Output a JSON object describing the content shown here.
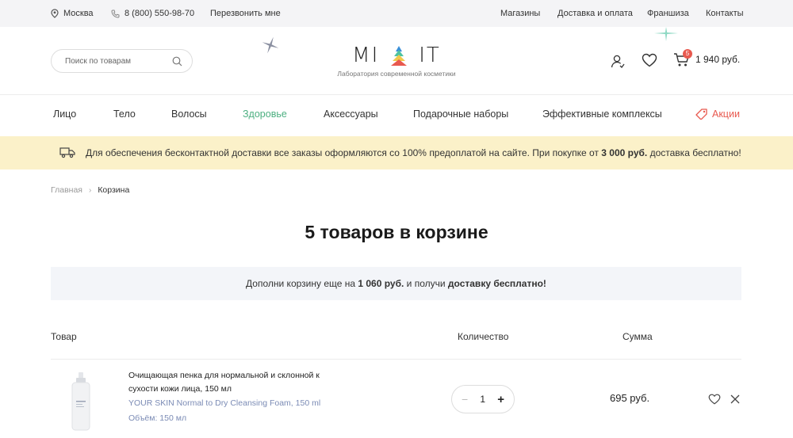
{
  "topbar": {
    "city": "Москва",
    "phone": "8 (800) 550-98-70",
    "callback": "Перезвонить мне",
    "links": [
      "Магазины",
      "Доставка и оплата",
      "Франшиза",
      "Контакты"
    ]
  },
  "header": {
    "search_placeholder": "Поиск по товарам",
    "logo_left": "MI",
    "logo_right": "IT",
    "tagline": "Лаборатория современной косметики",
    "cart_count": "5",
    "cart_total": "1 940 руб."
  },
  "nav": {
    "items": [
      "Лицо",
      "Тело",
      "Волосы",
      "Здоровье",
      "Аксессуары",
      "Подарочные наборы",
      "Эффективные комплексы"
    ],
    "active_index": 3,
    "promo": "Акции"
  },
  "banner": {
    "text_1": "Для обеспечения бесконтактной доставки все заказы оформляются со 100% предоплатой на сайте. При покупке от ",
    "amount": "3 000 руб.",
    "text_2": " доставка бесплатно!"
  },
  "breadcrumb": {
    "home": "Главная",
    "current": "Корзина"
  },
  "page": {
    "title": "5 товаров в корзине",
    "free_1": "Дополни корзину еще на ",
    "free_amount": "1 060 руб.",
    "free_2": " и получи ",
    "free_bold": "доставку бесплатно!"
  },
  "table": {
    "col_product": "Товар",
    "col_qty": "Количество",
    "col_sum": "Сумма"
  },
  "cart_items": [
    {
      "name": "Очищающая пенка для нормальной и склонной к сухости кожи лица, 150 мл",
      "name_en": "YOUR SKIN Normal to Dry Cleansing Foam, 150 ml",
      "volume": "Объём: 150 мл",
      "qty_minus": "−",
      "qty": "1",
      "qty_plus": "+",
      "sum": "695 руб."
    }
  ],
  "colors": {
    "accent_green": "#4caf80",
    "promo_red": "#e8594f",
    "banner_bg": "#fbf1c9",
    "muted_blue": "#7b8bb5"
  }
}
